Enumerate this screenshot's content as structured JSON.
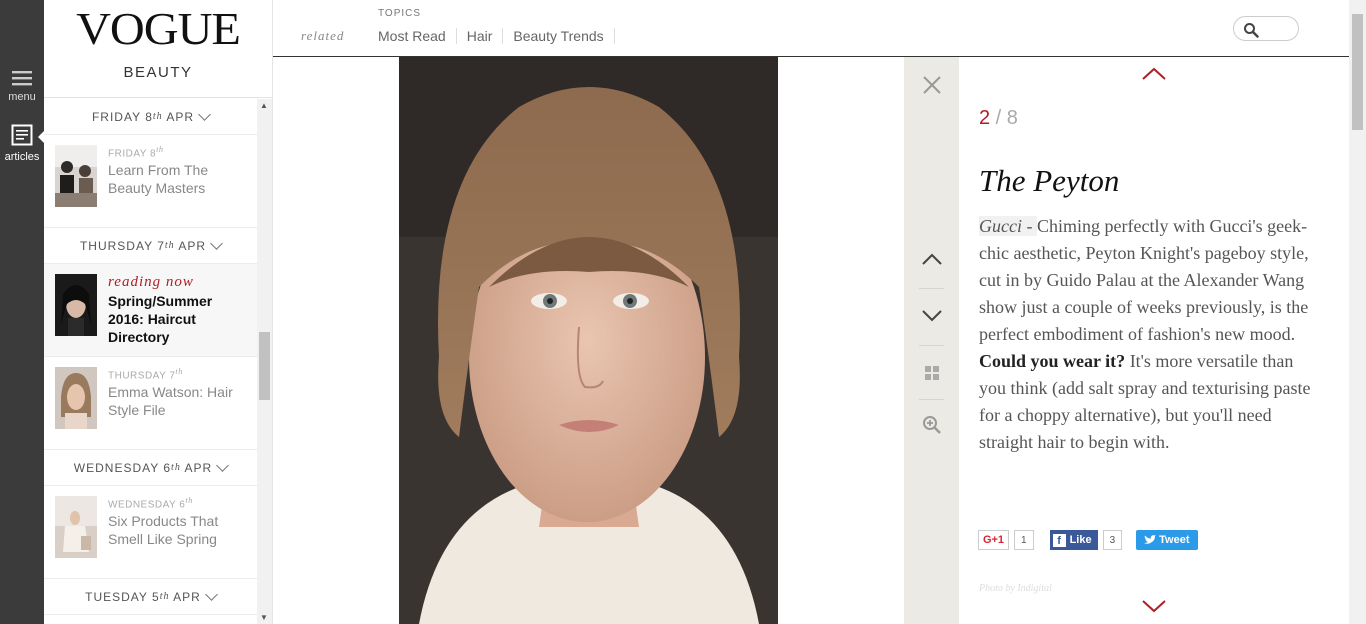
{
  "rail": {
    "menu_label": "menu",
    "articles_label": "articles"
  },
  "brand": {
    "logo": "VOGUE",
    "section": "BEAUTY"
  },
  "topnav": {
    "related": "related",
    "topics_label": "TOPICS",
    "links": [
      "Most Read",
      "Hair",
      "Beauty Trends"
    ]
  },
  "feed": {
    "dates": {
      "fri": {
        "label": "FRIDAY 8",
        "sup": "th",
        "tail": " APR"
      },
      "thu": {
        "label": "THURSDAY 7",
        "sup": "th",
        "tail": " APR"
      },
      "wed": {
        "label": "WEDNESDAY 6",
        "sup": "th",
        "tail": " APR"
      },
      "tue": {
        "label": "TUESDAY 5",
        "sup": "th",
        "tail": " APR"
      }
    },
    "items": [
      {
        "meta": "FRIDAY 8",
        "sup": "th",
        "title": "Learn From The Beauty Masters"
      },
      {
        "reading": "reading now",
        "title": "Spring/Summer 2016: Haircut Directory"
      },
      {
        "meta": "THURSDAY 7",
        "sup": "th",
        "title": "Emma Watson: Hair Style File"
      },
      {
        "meta": "WEDNESDAY 6",
        "sup": "th",
        "title": "Six Products That Smell Like Spring"
      }
    ]
  },
  "slide": {
    "current": "2",
    "separator": " / ",
    "total": "8",
    "title": "The Peyton",
    "brand": "Gucci",
    "dash": " - ",
    "text1": "Chiming perfectly with Gucci's geek-chic aesthetic, Peyton Knight's pageboy style, cut in by Guido Palau at the Alexander Wang show just a couple of weeks previously, is the perfect embodiment of fashion's new mood. ",
    "question": "Could you wear it?",
    "text2": " It's more versatile than you think (add salt spray and texturising paste for a choppy alternative), but you'll need straight hair to begin with.",
    "credit": "Photo by Indigital"
  },
  "social": {
    "gplus_label": "G+1",
    "gplus_count": "1",
    "fb_label": "Like",
    "fb_count": "3",
    "tweet_label": "Tweet"
  },
  "colors": {
    "accent": "#b01e23",
    "rail": "#3b3b3b",
    "ctrl_bg": "#ebeae4"
  }
}
